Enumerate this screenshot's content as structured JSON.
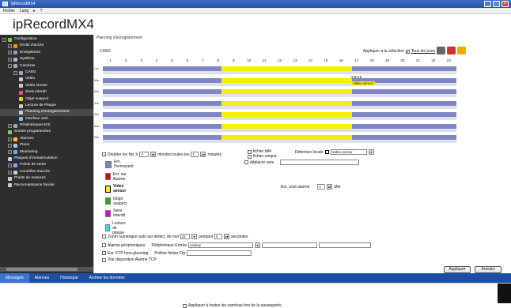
{
  "window": {
    "title": "IpRecordMX4"
  },
  "menu": [
    "Fichier",
    "Lang",
    "▸",
    "?"
  ],
  "brand": "ipRecordMX4",
  "sidebar": {
    "items": [
      {
        "label": "Configuration",
        "icon": "gear-icon",
        "level": 0,
        "toggle": "−"
      },
      {
        "label": "Droits d'accès",
        "icon": "key-icon",
        "level": 1,
        "toggle": "+"
      },
      {
        "label": "Enregistreur",
        "icon": "recorder-icon",
        "level": 1,
        "toggle": "+"
      },
      {
        "label": "Système",
        "icon": "system-icon",
        "level": 1,
        "toggle": "+"
      },
      {
        "label": "Caméras",
        "icon": "camera-icon",
        "level": 1,
        "toggle": "−"
      },
      {
        "label": "CAM2",
        "icon": "camera-icon",
        "level": 2,
        "toggle": "−"
      },
      {
        "label": "Vidéo",
        "icon": "video-icon",
        "level": 3
      },
      {
        "label": "Vidéo sensor",
        "icon": "sensor-icon",
        "level": 3
      },
      {
        "label": "Sens interdit",
        "icon": "no-entry-icon",
        "level": 3
      },
      {
        "label": "Objet suspect",
        "icon": "warning-icon",
        "level": 3
      },
      {
        "label": "Lecture de Plaque",
        "icon": "plate-icon",
        "level": 3
      },
      {
        "label": "Planning d'enregistrement",
        "icon": "search-icon",
        "level": 3,
        "selected": true
      },
      {
        "label": "Interface web",
        "icon": "web-icon",
        "level": 3
      },
      {
        "label": "Périphériques E/S",
        "icon": "io-icon",
        "level": 1,
        "toggle": "+"
      },
      {
        "label": "Sorties programmées",
        "icon": "output-icon",
        "level": 1
      },
      {
        "label": "Alarmes",
        "icon": "alarm-icon",
        "level": 1,
        "toggle": "+"
      },
      {
        "label": "Plans",
        "icon": "map-icon",
        "level": 1,
        "toggle": "+"
      },
      {
        "label": "Monitoring",
        "icon": "monitor-icon",
        "level": 1,
        "toggle": "+"
      },
      {
        "label": "Plaques d'immatriculation",
        "icon": "plate-icon",
        "level": 1
      },
      {
        "label": "Points de vente",
        "icon": "pos-icon",
        "level": 1,
        "toggle": "+"
      },
      {
        "label": "Contrôles d'accès",
        "icon": "access-icon",
        "level": 1,
        "toggle": "+"
      },
      {
        "label": "Points de mesures",
        "icon": "measure-icon",
        "level": 1
      },
      {
        "label": "Reconnaissance faciale",
        "icon": "face-icon",
        "level": 1
      }
    ]
  },
  "main": {
    "panel_title": "Planning d'enregistrement",
    "camera": "CAM2",
    "apply_selection": "Appliquer à la sélection",
    "all_days": "Tous les jours",
    "hours": [
      "1",
      "2",
      "3",
      "4",
      "5",
      "6",
      "7",
      "8",
      "9",
      "10",
      "11",
      "12",
      "13",
      "14",
      "15",
      "16",
      "17",
      "18",
      "19",
      "20",
      "21",
      "22",
      "23"
    ],
    "days": [
      "Lun",
      "Mar",
      "Mer",
      "Jeu",
      "Ven",
      "Sam",
      "Dim"
    ],
    "tip_time": "24H15",
    "tip_type": "Vidéo sensor",
    "options": {
      "double_fps": "Doubler les fps",
      "at": "à",
      "minutes_every": "minutes toutes les",
      "minutes": "minutes",
      "fichier_tdf": "fichier tdf4",
      "fichier_unique": "fichier unique",
      "deplacer_vers": "déplacer vers",
      "detection_locale": "Détection locale",
      "detection_value": "Video sensor",
      "fps_value": "7",
      "every_value": "1",
      "post_alarm_label": "Enr. post alarme",
      "post_alarm_value": "1",
      "min_label": "Min"
    },
    "legend": [
      {
        "label": "Enr. Permanent",
        "color": "#7f86c4"
      },
      {
        "label": "Enr. sur Alarme",
        "color": "#e00000"
      },
      {
        "label": "Video sensor",
        "color": "#f4f000",
        "bold": true
      },
      {
        "label": "Objet suspect",
        "color": "#23b100"
      },
      {
        "label": "Sens interdit",
        "color": "#e000d8"
      },
      {
        "label": "Lecture de plaque",
        "color": "#3fd8f4"
      }
    ],
    "zoom_label": "Zoom numérique auto sur détect. de mvt",
    "zoom_value": "x2",
    "pendant": "pendant",
    "pendant_value": "5",
    "secondes": "secondes",
    "alarm_periph": "Alarme périphériques",
    "periph_entree": "Périphérique Entrée",
    "periph_value": "cassey",
    "ftp": "Enr. FTP hors-planning",
    "prefix_ftp": "Préfixe fichier Ftp",
    "view_alarm": "Voir disposition Alarme TCP",
    "apply_all": "Appliquer à toutes les caméras lors de la sauvegarde",
    "apply_btn": "Appliquer",
    "cancel_btn": "Annuler"
  },
  "tabs": [
    "Messages",
    "Alarmes",
    "Historique",
    "Archive les données"
  ]
}
